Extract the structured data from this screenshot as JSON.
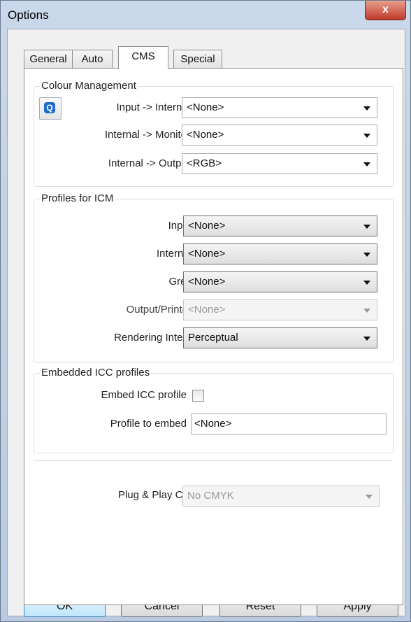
{
  "window": {
    "title": "Options",
    "close_label": "x"
  },
  "tabs": [
    {
      "label": "General",
      "active": false
    },
    {
      "label": "Auto",
      "active": false
    },
    {
      "label": "CMS",
      "active": true
    },
    {
      "label": "Special",
      "active": false
    }
  ],
  "colour_management": {
    "legend": "Colour Management",
    "rows": [
      {
        "label": "Input -> Internal",
        "value": "<None>"
      },
      {
        "label": "Internal -> Monitor",
        "value": "<None>"
      },
      {
        "label": "Internal -> Output",
        "value": "<RGB>"
      }
    ]
  },
  "profiles_icm": {
    "legend": "Profiles for ICM",
    "rows": [
      {
        "label": "Input",
        "value": "<None>",
        "enabled": true
      },
      {
        "label": "Internal",
        "value": "<None>",
        "enabled": true
      },
      {
        "label": "Grey",
        "value": "<None>",
        "enabled": true
      },
      {
        "label": "Output/Printer",
        "value": "<None>",
        "enabled": false
      },
      {
        "label": "Rendering Intent",
        "value": "Perceptual",
        "enabled": true
      }
    ]
  },
  "embedded": {
    "legend": "Embedded ICC profiles",
    "embed_label": "Embed ICC profile",
    "embed_checked": false,
    "profile_label": "Profile to embed",
    "profile_value": "<None>"
  },
  "plug_play": {
    "label": "Plug & Play CMYK",
    "value": "No CMYK",
    "enabled": false
  },
  "buttons": {
    "ok": "OK",
    "cancel": "Cancel",
    "reset": "Reset",
    "apply": "Apply"
  },
  "icons": {
    "cms_icon": "color-management-icon",
    "close": "close-icon"
  }
}
